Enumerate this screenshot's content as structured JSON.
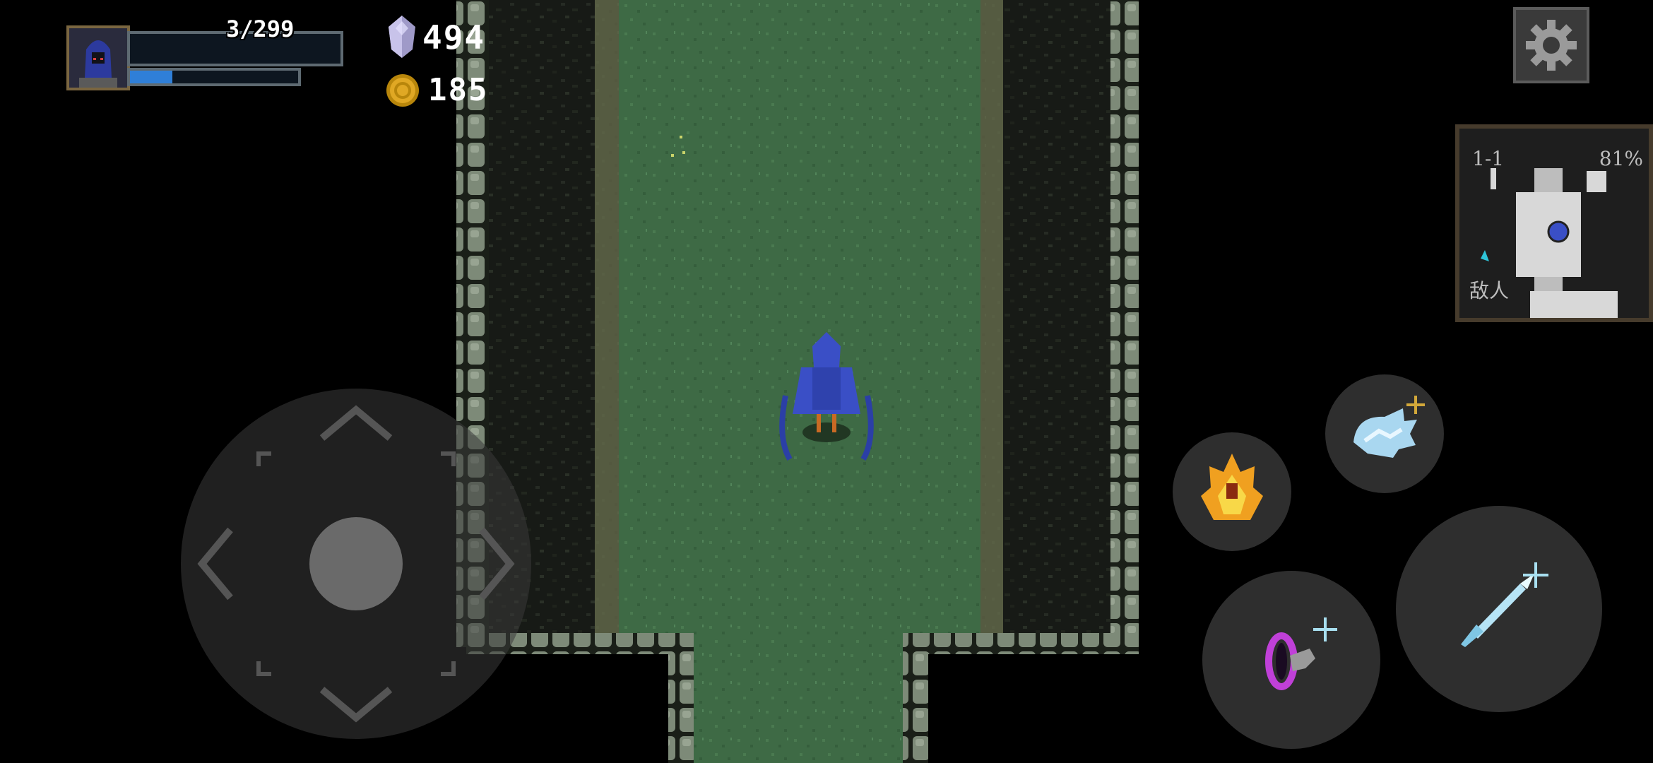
{
  "hud": {
    "hp_text": "3/299",
    "mana_fill_fraction": 0.25,
    "gems": "494",
    "coins": "185"
  },
  "minimap": {
    "level": "1-1",
    "explored": "81%",
    "enemy_label": "敌人"
  },
  "skills": {
    "frost_icon": "frost-claw-icon",
    "fire_icon": "fireball-icon",
    "portal_icon": "dash-portal-icon",
    "attack_icon": "ice-spear-icon"
  },
  "colors": {
    "grass": "#3e6a45",
    "wall": "#1b1f1a",
    "stone": "#7d8a78",
    "mana": "#2f7fd8",
    "player": "#3a4fc6"
  }
}
